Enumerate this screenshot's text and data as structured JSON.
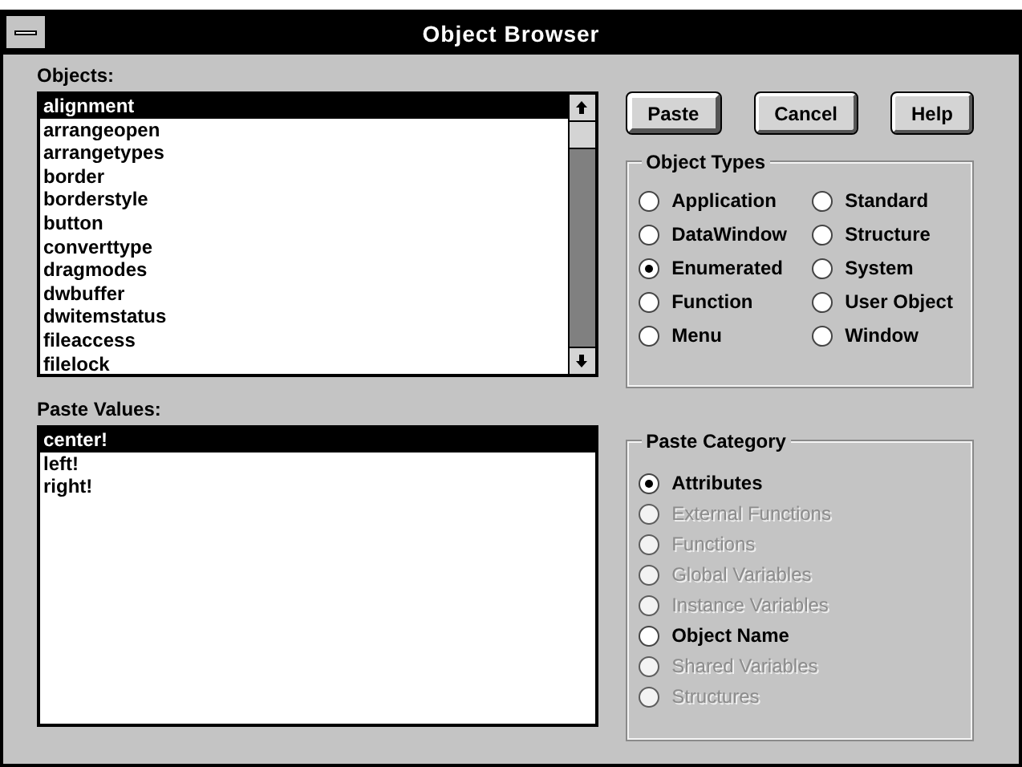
{
  "window": {
    "title": "Object Browser"
  },
  "objects": {
    "label": "Objects:",
    "items": [
      {
        "text": "alignment",
        "selected": true
      },
      {
        "text": "arrangeopen",
        "selected": false
      },
      {
        "text": "arrangetypes",
        "selected": false
      },
      {
        "text": "border",
        "selected": false
      },
      {
        "text": "borderstyle",
        "selected": false
      },
      {
        "text": "button",
        "selected": false
      },
      {
        "text": "converttype",
        "selected": false
      },
      {
        "text": "dragmodes",
        "selected": false
      },
      {
        "text": "dwbuffer",
        "selected": false
      },
      {
        "text": "dwitemstatus",
        "selected": false
      },
      {
        "text": "fileaccess",
        "selected": false
      },
      {
        "text": "filelock",
        "selected": false
      }
    ]
  },
  "buttons": [
    {
      "label": "Paste",
      "default": true
    },
    {
      "label": "Cancel",
      "default": false
    },
    {
      "label": "Help",
      "default": false
    }
  ],
  "object_types": {
    "title": "Object Types",
    "options": [
      {
        "label": "Application",
        "selected": false
      },
      {
        "label": "Standard",
        "selected": false
      },
      {
        "label": "DataWindow",
        "selected": false
      },
      {
        "label": "Structure",
        "selected": false
      },
      {
        "label": "Enumerated",
        "selected": true
      },
      {
        "label": "System",
        "selected": false
      },
      {
        "label": "Function",
        "selected": false
      },
      {
        "label": "User Object",
        "selected": false
      },
      {
        "label": "Menu",
        "selected": false
      },
      {
        "label": "Window",
        "selected": false
      }
    ]
  },
  "paste_values": {
    "label": "Paste Values:",
    "items": [
      {
        "text": "center!",
        "selected": true
      },
      {
        "text": "left!",
        "selected": false
      },
      {
        "text": "right!",
        "selected": false
      }
    ]
  },
  "paste_category": {
    "title": "Paste Category",
    "options": [
      {
        "label": "Attributes",
        "selected": true,
        "disabled": false
      },
      {
        "label": "External Functions",
        "selected": false,
        "disabled": true
      },
      {
        "label": "Functions",
        "selected": false,
        "disabled": true
      },
      {
        "label": "Global Variables",
        "selected": false,
        "disabled": true
      },
      {
        "label": "Instance Variables",
        "selected": false,
        "disabled": true
      },
      {
        "label": "Object Name",
        "selected": false,
        "disabled": false
      },
      {
        "label": "Shared Variables",
        "selected": false,
        "disabled": true
      },
      {
        "label": "Structures",
        "selected": false,
        "disabled": true
      }
    ]
  }
}
